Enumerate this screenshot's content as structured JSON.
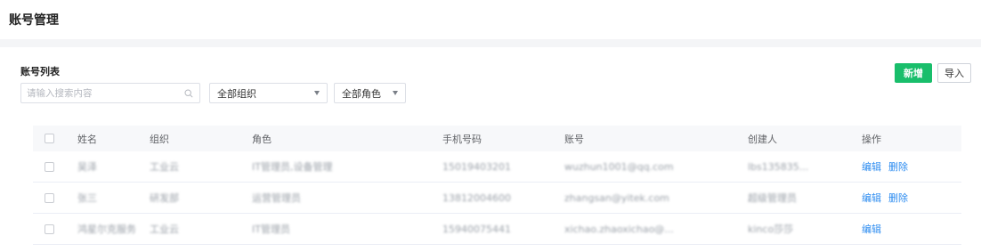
{
  "page": {
    "title": "账号管理"
  },
  "section": {
    "title": "账号列表"
  },
  "search": {
    "placeholder": "请输入搜索内容"
  },
  "filters": {
    "org": "全部组织",
    "role": "全部角色"
  },
  "toolbar": {
    "add_label": "新增",
    "import_label": "导入"
  },
  "table": {
    "headers": [
      "姓名",
      "组织",
      "角色",
      "手机号码",
      "账号",
      "创建人",
      "操作"
    ],
    "rows": [
      {
        "name": "吴泽",
        "org": "工业云",
        "role": "IT管理员,设备管理",
        "phone": "15019403201",
        "account": "wuzhun1001@qq.com",
        "creator": "lbs135835...",
        "actions": [
          "编辑",
          "删除"
        ]
      },
      {
        "name": "张三",
        "org": "研发部",
        "role": "运营管理员",
        "phone": "13812004600",
        "account": "zhangsan@yitek.com",
        "creator": "超级管理员",
        "actions": [
          "编辑",
          "删除"
        ]
      },
      {
        "name": "鸿星尔克服务",
        "org": "工业云",
        "role": "IT管理员",
        "phone": "15940075441",
        "account": "xichao.zhaoxichao@...",
        "creator": "kinco莎莎",
        "actions": [
          "编辑"
        ]
      }
    ]
  }
}
